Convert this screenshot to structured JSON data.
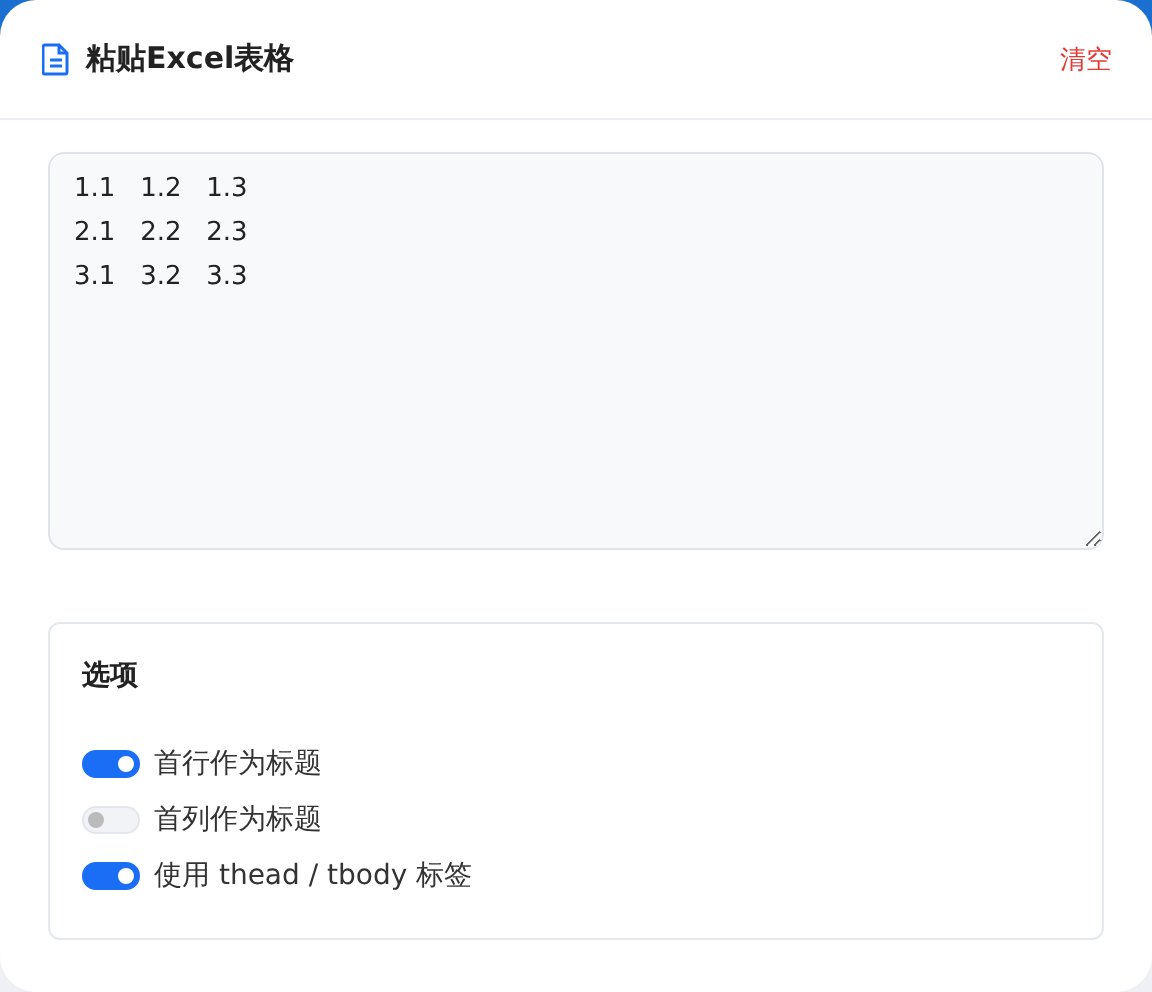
{
  "header": {
    "title": "粘贴Excel表格",
    "clear_button": "清空"
  },
  "paste_area": {
    "value": "1.1\t1.2\t1.3\n2.1\t2.2\t2.3\n3.1\t3.2\t3.3"
  },
  "options": {
    "title": "选项",
    "items": [
      {
        "label": "首行作为标题",
        "on": true
      },
      {
        "label": "首列作为标题",
        "on": false
      },
      {
        "label": "使用 thead / tbody 标签",
        "on": true
      }
    ]
  }
}
